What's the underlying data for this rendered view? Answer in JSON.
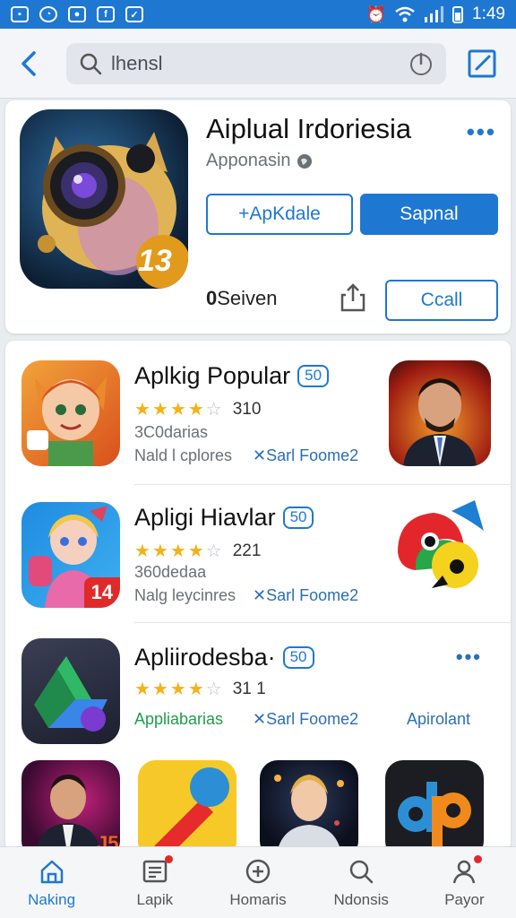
{
  "status_bar": {
    "time": "1:49",
    "app_icons": [
      "camera-icon",
      "alarm-icon",
      "chat-icon",
      "news-icon",
      "check-icon"
    ]
  },
  "header": {
    "search_query": "lhensl"
  },
  "featured": {
    "title": "Aiplual Irdoriesia",
    "subtitle": "Apponasin",
    "icon_badge": "13",
    "btn_secondary": "+ApKdale",
    "btn_primary": "Sapnal",
    "count_number": "0",
    "count_label": "Seiven",
    "btn_call": "Ccall"
  },
  "list": [
    {
      "name": "Aplkig Popular",
      "badge": "50",
      "rating": 4,
      "rating_value": "310",
      "line1": "3C0darias",
      "line2": "Nald l cplores",
      "developer": "✕Sarl Foome2"
    },
    {
      "name": "Apligi Hiavlar",
      "badge": "50",
      "rating": 4,
      "rating_value": "221",
      "line1": "360dedaa",
      "line2": "Nalg leycinres",
      "developer": "✕Sarl Foome2",
      "icon_badge": "14"
    },
    {
      "name": "Apliirodesba·",
      "badge": "50",
      "rating": 4,
      "rating_value": "31 1",
      "line1": "Appliabarias",
      "developer": "✕Sarl Foome2",
      "right_text": "Apirolant"
    }
  ],
  "tabs": [
    {
      "label": "Naking",
      "icon": "home-icon",
      "active": true
    },
    {
      "label": "Lapik",
      "icon": "list-icon",
      "badge": true
    },
    {
      "label": "Homaris",
      "icon": "plus-circle-icon"
    },
    {
      "label": "Ndonsis",
      "icon": "search-icon"
    },
    {
      "label": "Payor",
      "icon": "profile-icon",
      "badge": true
    }
  ],
  "colors": {
    "accent": "#1e78d2",
    "status_bar": "#1e78d2",
    "star": "#f3b21a",
    "green_text": "#1e9e4a"
  }
}
